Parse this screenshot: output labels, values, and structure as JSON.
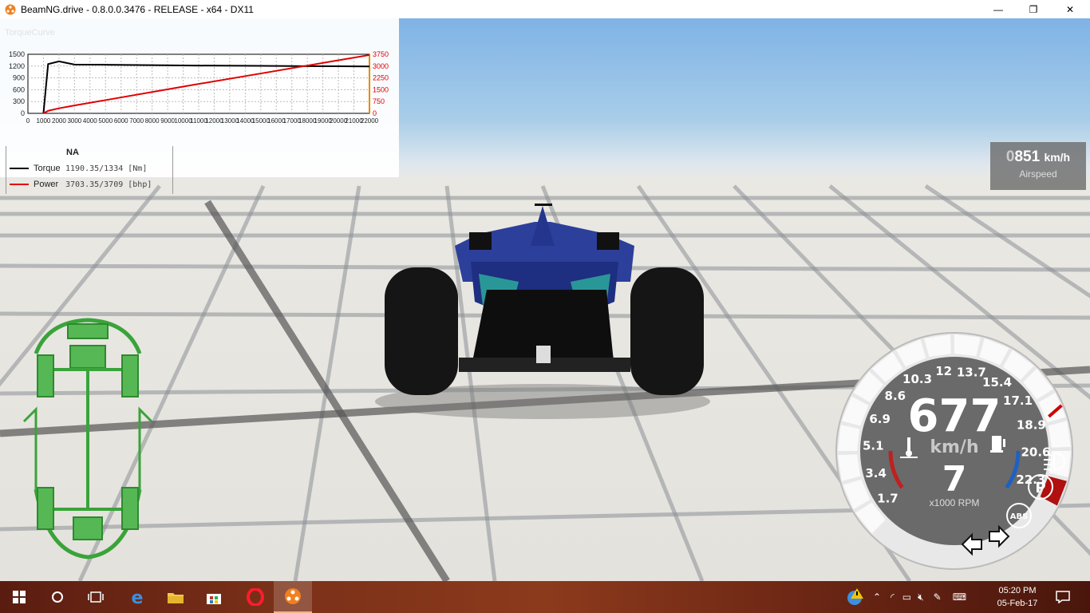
{
  "window": {
    "title": "BeamNG.drive - 0.8.0.0.3476 - RELEASE - x64 - DX11",
    "minimize": "—",
    "maximize": "❐",
    "close": "✕"
  },
  "graph": {
    "panel_title": "TorqueCurve",
    "left_axis_ticks": [
      "1500",
      "1200",
      "900",
      "600",
      "300",
      "0"
    ],
    "right_axis_ticks": [
      "3750",
      "3000",
      "2250",
      "1500",
      "750",
      "0"
    ],
    "x_axis_ticks": [
      "0",
      "1000",
      "2000",
      "3000",
      "4000",
      "5000",
      "6000",
      "7000",
      "8000",
      "9000",
      "10000",
      "11000",
      "12000",
      "13000",
      "14000",
      "15000",
      "16000",
      "17000",
      "18000",
      "19000",
      "20000",
      "21000",
      "22000"
    ],
    "engine_name": "NA",
    "torque_label": "Torque",
    "torque_value": "1190.35/1334 [Nm]",
    "power_label": "Power",
    "power_value": "3703.35/3709 [bhp]",
    "torque_color": "#000000",
    "power_color": "#e00000"
  },
  "chart_data": {
    "type": "line",
    "x": [
      1000,
      1300,
      2000,
      3000,
      5000,
      10000,
      15000,
      20000,
      22000
    ],
    "series": [
      {
        "name": "Torque",
        "axis": "left",
        "values": [
          0,
          1250,
          1320,
          1240,
          1235,
          1215,
          1205,
          1195,
          1190
        ]
      },
      {
        "name": "Power",
        "axis": "right",
        "values": [
          0,
          160,
          320,
          500,
          840,
          1700,
          2530,
          3370,
          3703
        ]
      }
    ],
    "xlim": [
      0,
      22000
    ],
    "ylim_left": [
      0,
      1500
    ],
    "ylim_right": [
      0,
      3750
    ]
  },
  "airspeed": {
    "value_dim": "0",
    "value": "851",
    "unit": "km/h",
    "label": "Airspeed"
  },
  "gauge": {
    "speed": "677",
    "speed_unit": "km/h",
    "gear": "7",
    "rpm_unit": "x1000 RPM",
    "rpm_ticks": [
      "1.7",
      "3.4",
      "5.1",
      "6.9",
      "8.6",
      "10.3",
      "12",
      "13.7",
      "15.4",
      "17.1",
      "18.9",
      "20.6",
      "22.3"
    ],
    "abs_label": "ABS",
    "parking_label": "P",
    "redline_color": "#b01010"
  },
  "taskbar": {
    "clock_time": "05:20 PM",
    "clock_date": "05-Feb-17"
  }
}
